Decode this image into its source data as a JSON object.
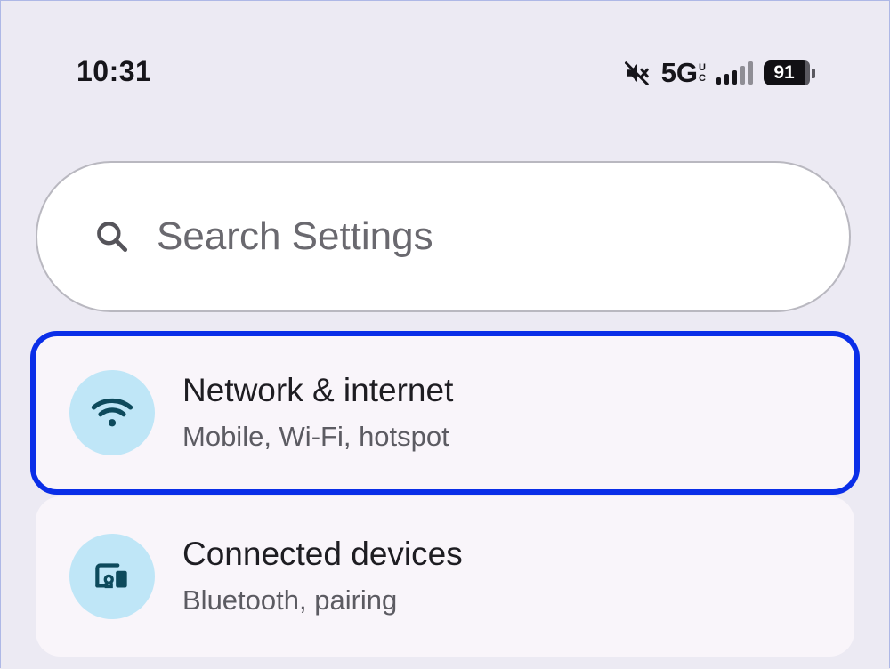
{
  "status_bar": {
    "time": "10:31",
    "network_type": "5G",
    "network_type_suffix_top": "U",
    "network_type_suffix_bottom": "C",
    "signal_bars": 5,
    "signal_bars_filled": 3,
    "battery_level": "91",
    "icons": [
      "mute-icon",
      "signal-icon",
      "battery-icon"
    ]
  },
  "search": {
    "placeholder": "Search Settings",
    "icon": "search-icon"
  },
  "settings": [
    {
      "title": "Network & internet",
      "subtitle": "Mobile, Wi-Fi, hotspot",
      "icon": "wifi-icon",
      "highlighted": true
    },
    {
      "title": "Connected devices",
      "subtitle": "Bluetooth, pairing",
      "icon": "connected-devices-icon",
      "highlighted": false
    }
  ],
  "colors": {
    "background": "#eceaf3",
    "card": "#f9f5fa",
    "icon_circle": "#bfe6f7",
    "icon_glyph": "#0d4a5c",
    "highlight_border": "#0a2ee8"
  }
}
